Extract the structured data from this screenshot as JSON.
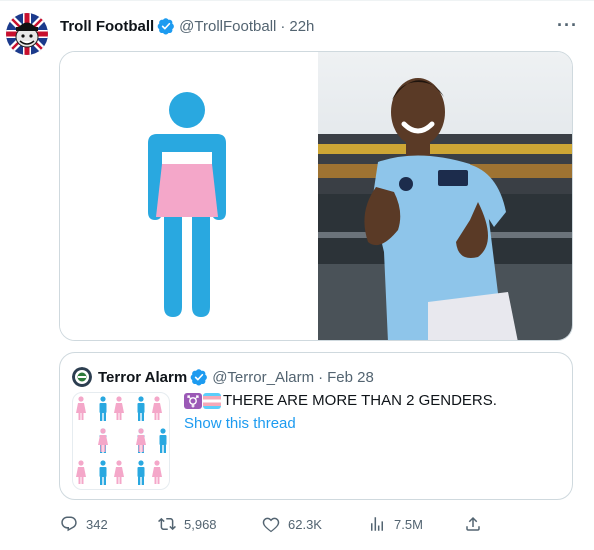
{
  "tweet": {
    "display_name": "Troll Football",
    "handle": "@TrollFootball",
    "separator": "·",
    "time": "22h",
    "more_icon": "more-dots-icon"
  },
  "quoted_tweet": {
    "display_name": "Terror Alarm",
    "handle": "@Terror_Alarm",
    "separator": "·",
    "date": "Feb 28",
    "text": "THERE ARE MORE THAN 2 GENDERS.",
    "show_thread": "Show this thread"
  },
  "actions": {
    "replies": "342",
    "retweets": "5,968",
    "likes": "62.3K",
    "views": "7.5M"
  },
  "colors": {
    "accent": "#1d9bf0",
    "muted": "#536471",
    "border": "#cfd9de",
    "toilet_blue": "#29a8e0",
    "toilet_pink": "#f4a7c9",
    "city_blue": "#8ec5ea"
  }
}
